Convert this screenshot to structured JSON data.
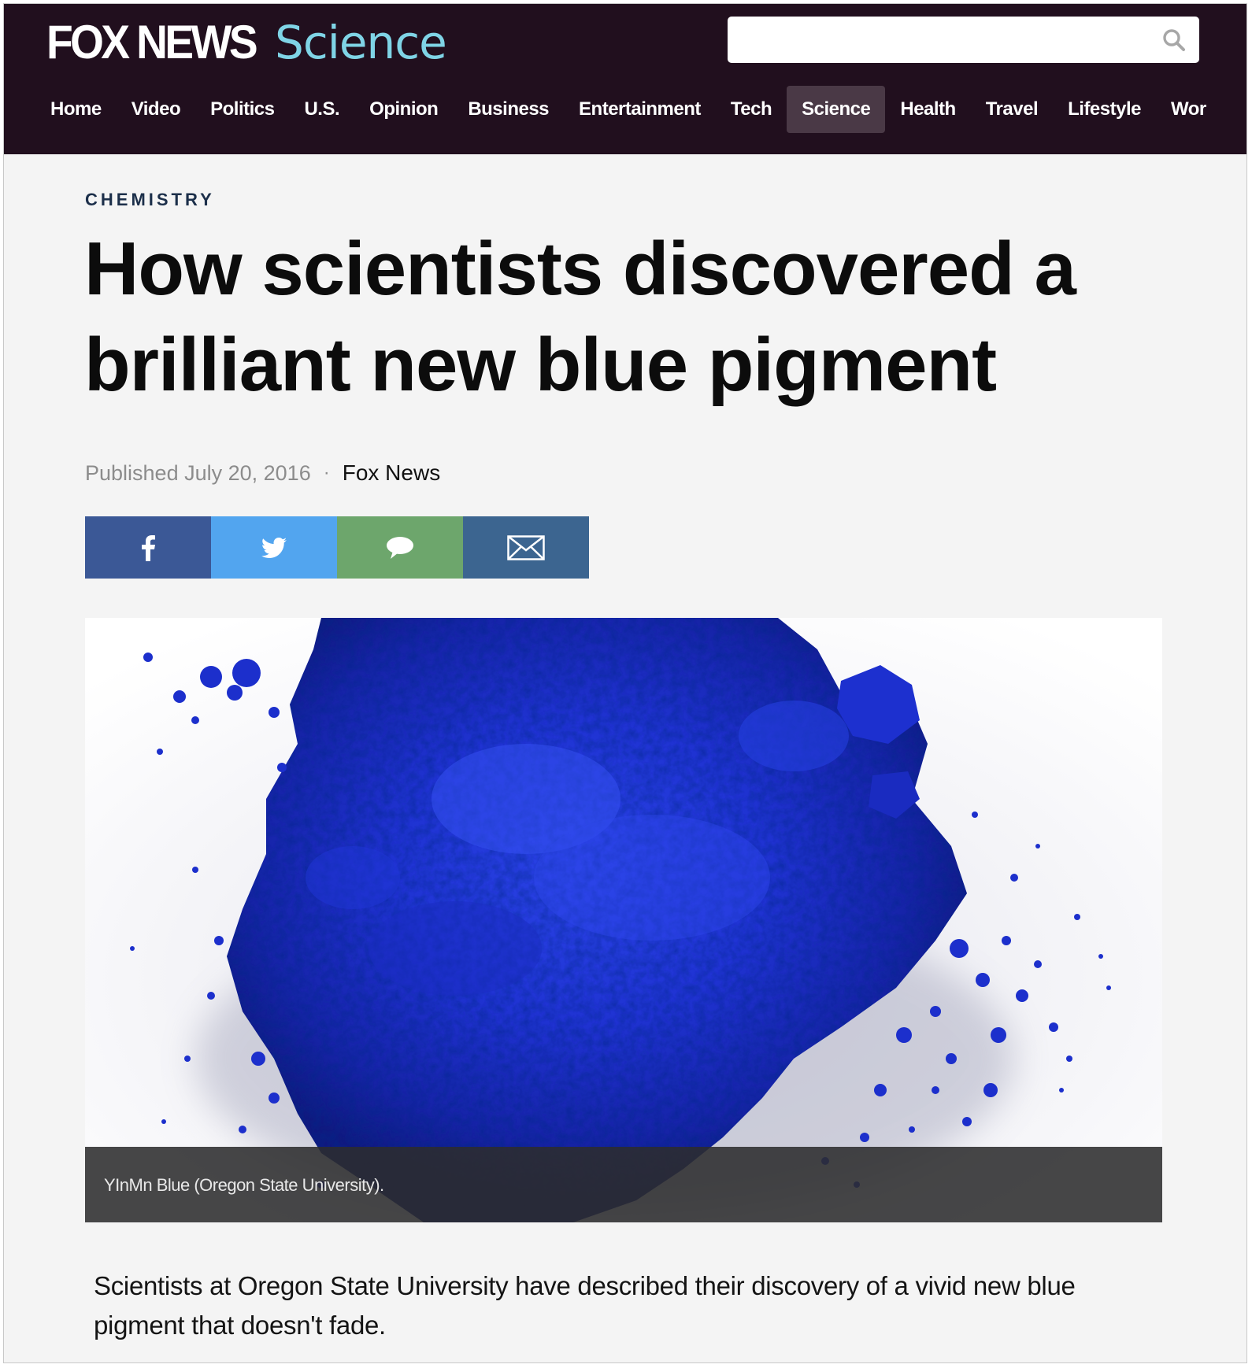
{
  "header": {
    "logo_main": "FOX NEWS",
    "logo_section": "Science",
    "search_placeholder": "",
    "nav": [
      {
        "label": "Home"
      },
      {
        "label": "Video"
      },
      {
        "label": "Politics"
      },
      {
        "label": "U.S."
      },
      {
        "label": "Opinion"
      },
      {
        "label": "Business"
      },
      {
        "label": "Entertainment"
      },
      {
        "label": "Tech"
      },
      {
        "label": "Science",
        "active": true
      },
      {
        "label": "Health"
      },
      {
        "label": "Travel"
      },
      {
        "label": "Lifestyle"
      },
      {
        "label": "Wor"
      }
    ]
  },
  "article": {
    "category": "CHEMISTRY",
    "headline": "How scientists discovered a brilliant new blue pigment",
    "published": "Published July 20, 2016",
    "separator": "·",
    "source": "Fox News",
    "share": [
      {
        "network": "facebook",
        "icon": "facebook-icon",
        "color": "#3b5896"
      },
      {
        "network": "twitter",
        "icon": "twitter-icon",
        "color": "#52a5ef"
      },
      {
        "network": "comments",
        "icon": "comment-icon",
        "color": "#6da66c"
      },
      {
        "network": "email",
        "icon": "email-icon",
        "color": "#3c6590"
      }
    ],
    "image": {
      "subject": "blue-pigment-powder",
      "caption": "YInMn Blue (Oregon State University)."
    },
    "lede": "Scientists at Oregon State University have described their discovery of a vivid new blue pigment that doesn't fade."
  },
  "colors": {
    "header_bg": "#210f1e",
    "accent_section": "#7fd4e6",
    "nav_active_bg": "#4a3946",
    "pigment_blue": "#1d2fd2"
  }
}
